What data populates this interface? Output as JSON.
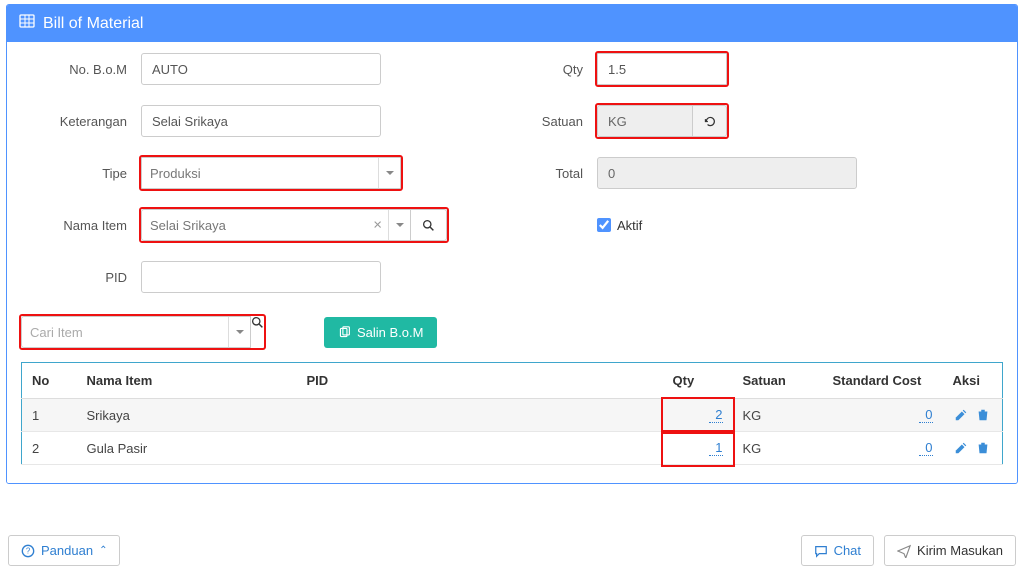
{
  "panel": {
    "title": "Bill of Material"
  },
  "labels": {
    "no_bom": "No. B.o.M",
    "keterangan": "Keterangan",
    "tipe": "Tipe",
    "nama_item": "Nama Item",
    "pid": "PID",
    "qty": "Qty",
    "satuan": "Satuan",
    "total": "Total",
    "aktif": "Aktif"
  },
  "values": {
    "no_bom": "AUTO",
    "keterangan": "Selai Srikaya",
    "tipe": "Produksi",
    "nama_item": "Selai Srikaya",
    "pid": "",
    "qty": "1.5",
    "satuan": "KG",
    "total": "0",
    "aktif_checked": true
  },
  "search": {
    "placeholder": "Cari Item"
  },
  "buttons": {
    "salin": "Salin B.o.M",
    "panduan": "Panduan",
    "chat": "Chat",
    "kirim": "Kirim Masukan"
  },
  "table": {
    "headers": {
      "no": "No",
      "nama": "Nama Item",
      "pid": "PID",
      "qty": "Qty",
      "satuan": "Satuan",
      "cost": "Standard Cost",
      "aksi": "Aksi"
    },
    "rows": [
      {
        "no": "1",
        "nama": "Srikaya",
        "pid": "",
        "qty": "2",
        "satuan": "KG",
        "cost": "0"
      },
      {
        "no": "2",
        "nama": "Gula Pasir",
        "pid": "",
        "qty": "1",
        "satuan": "KG",
        "cost": "0"
      }
    ]
  }
}
